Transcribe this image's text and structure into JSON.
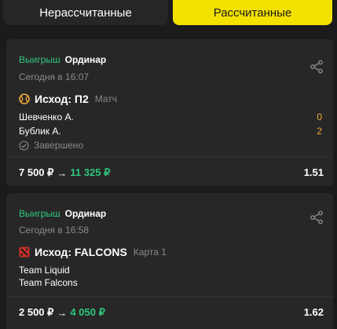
{
  "tabs": {
    "unsettled": "Нерассчитанные",
    "settled": "Рассчитанные"
  },
  "bets": [
    {
      "result": "Выигрыш",
      "kind": "Ординар",
      "date": "Сегодня в 16:07",
      "outcome": "Исход: П2",
      "outcome_sub": "Матч",
      "sport_icon": "tennis-ball-icon",
      "teams": [
        "Шевченко А.",
        "Бублик А."
      ],
      "scores": [
        "0",
        "2"
      ],
      "status": "Завершено",
      "stake": "7 500 ₽",
      "payout": "11 325 ₽",
      "odds": "1.51"
    },
    {
      "result": "Выигрыш",
      "kind": "Ординар",
      "date": "Сегодня в 16:58",
      "outcome": "Исход: FALCONS",
      "outcome_sub": "Карта 1",
      "sport_icon": "dota2-icon",
      "teams": [
        "Team Liquid",
        "Team Falcons"
      ],
      "stake": "2 500 ₽",
      "payout": "4 050 ₽",
      "odds": "1.62"
    }
  ],
  "colors": {
    "win": "#2fc77c",
    "accent": "#f3e200",
    "score": "#f2a93b"
  },
  "arrow": "→"
}
